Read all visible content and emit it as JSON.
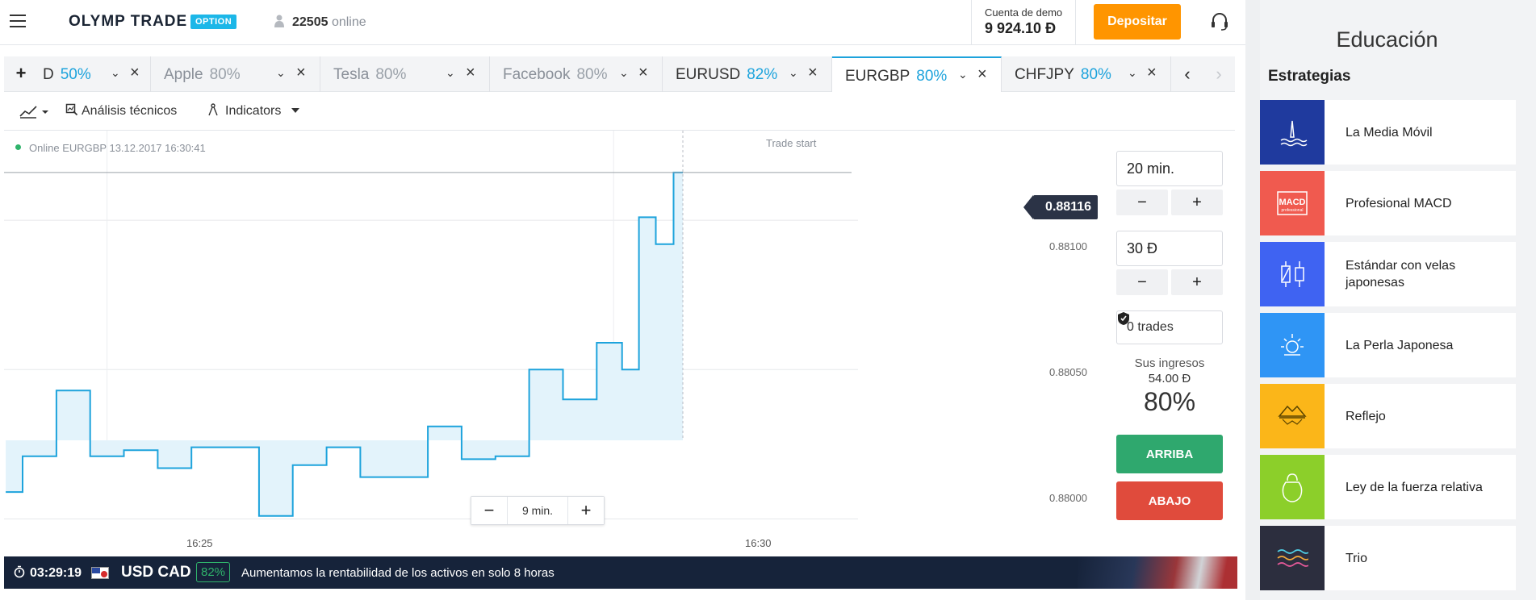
{
  "header": {
    "logo": "OLYMP TRADE",
    "logo_badge": "OPTION",
    "online_count": "22505",
    "online_label": "online",
    "account_label": "Cuenta de demo",
    "account_value": "9 924.10 Đ",
    "deposit_label": "Depositar"
  },
  "tabs": [
    {
      "name": "D",
      "pct": "50%"
    },
    {
      "name": "Apple",
      "pct": "80%"
    },
    {
      "name": "Tesla",
      "pct": "80%"
    },
    {
      "name": "Facebook",
      "pct": "80%"
    },
    {
      "name": "EURUSD",
      "pct": "82%"
    },
    {
      "name": "EURGBP",
      "pct": "80%"
    },
    {
      "name": "CHFJPY",
      "pct": "80%"
    }
  ],
  "toolbar": {
    "analysis_label": "Análisis técnicos",
    "indicators_label": "Indicators"
  },
  "chart": {
    "status": "Online EURGBP 13.12.2017 16:30:41",
    "trade_start": "Trade start",
    "current_price": "0.88116",
    "y_labels": [
      "0.88100",
      "0.88050",
      "0.88000"
    ],
    "x_labels": [
      "16:25",
      "16:30"
    ],
    "zoom_value": "9 min.",
    "line_color": "#1da3dc",
    "fill_color": "#e3f3fb"
  },
  "chart_data": {
    "type": "area",
    "series": [
      {
        "x": [
          "16:24:00",
          "16:24:20",
          "16:24:40",
          "16:25:00",
          "16:25:20",
          "16:25:40",
          "16:26:00",
          "16:26:20",
          "16:26:40",
          "16:27:00",
          "16:27:20",
          "16:27:40",
          "16:28:00",
          "16:28:20",
          "16:28:40",
          "16:29:00",
          "16:29:20",
          "16:29:40",
          "16:30:00",
          "16:30:10",
          "16:30:20",
          "16:30:30",
          "16:30:41"
        ],
        "values": [
          0.88009,
          0.88021,
          0.88043,
          0.88021,
          0.88023,
          0.88017,
          0.88024,
          0.88024,
          0.88001,
          0.88018,
          0.88024,
          0.88014,
          0.88014,
          0.88031,
          0.8802,
          0.88021,
          0.8805,
          0.8804,
          0.88059,
          0.8805,
          0.88101,
          0.88092,
          0.88116
        ]
      }
    ],
    "ylim": [
      0.87995,
      0.8813
    ],
    "y_ticks": [
      0.88,
      0.8805,
      0.881
    ],
    "x_ticks": [
      "16:25",
      "16:30"
    ],
    "grid": true
  },
  "trade_panel": {
    "duration": "20 min.",
    "amount": "30 Đ",
    "minus": "−",
    "plus": "+",
    "trades": "0 trades",
    "income_label": "Sus ingresos",
    "income_value": "54.00 Đ",
    "income_pct": "80%",
    "up_label": "ARRIBA",
    "down_label": "ABAJO"
  },
  "promo": {
    "timer": "03:29:19",
    "pair": "USD CAD",
    "badge": "82%",
    "message": "Aumentamos la rentabilidad de los activos en solo 8 horas"
  },
  "education": {
    "title": "Educación",
    "section": "Estrategias",
    "cards": [
      {
        "title": "La Media Móvil",
        "color": "#1f3a9e",
        "icon": "surfer-icon"
      },
      {
        "title": "Profesional MACD",
        "color": "#f05a4f",
        "icon": "macd-icon",
        "icon_text": "MACD",
        "icon_subtext": "professional"
      },
      {
        "title": "Estándar con velas japonesas",
        "color": "#3f63f2",
        "icon": "candles-icon"
      },
      {
        "title": "La Perla Japonesa",
        "color": "#2f95f5",
        "icon": "pearl-icon"
      },
      {
        "title": "Reflejo",
        "color": "#fbb619",
        "icon": "mountain-reflection-icon"
      },
      {
        "title": "Ley de la fuerza relativa",
        "color": "#8ccf2a",
        "icon": "kettlebell-icon"
      },
      {
        "title": "Trio",
        "color": "#2c2e3e",
        "icon": "waves-icon"
      }
    ]
  }
}
